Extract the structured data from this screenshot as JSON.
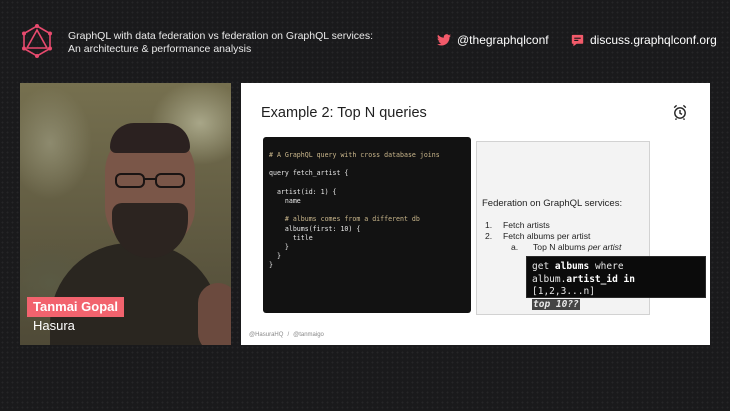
{
  "header": {
    "event_title_line1": "GraphQL with data federation vs federation on GraphQL services:",
    "event_title_line2": "An architecture & performance analysis",
    "twitter_handle": "@thegraphqlconf",
    "discuss_url": "discuss.graphqlconf.org",
    "icons": {
      "logo": "graphql-conf-logo",
      "twitter": "twitter-icon",
      "discuss": "chat-icon"
    },
    "colors": {
      "logo": "#e84a6e",
      "twitter": "#f25a6a",
      "discuss": "#f25a6a"
    }
  },
  "speaker": {
    "name": "Tanmai Gopal",
    "company": "Hasura",
    "name_tag_color": "#f2636e"
  },
  "slide": {
    "title": "Example 2: Top N queries",
    "icon": "alarm-clock-icon",
    "code_lines": [
      {
        "text": "# A GraphQL query with cross database joins",
        "comment": true
      },
      {
        "text": "",
        "comment": false
      },
      {
        "text": "query fetch_artist {",
        "comment": false
      },
      {
        "text": "",
        "comment": false
      },
      {
        "text": "  artist(id: 1) {",
        "comment": false
      },
      {
        "text": "    name",
        "comment": false
      },
      {
        "text": "",
        "comment": false
      },
      {
        "text": "    # albums comes from a different db",
        "comment": true
      },
      {
        "text": "    albums(first: 10) {",
        "comment": false
      },
      {
        "text": "      title",
        "comment": false
      },
      {
        "text": "    }",
        "comment": false
      },
      {
        "text": "  }",
        "comment": false
      },
      {
        "text": "}",
        "comment": false
      }
    ],
    "notes": {
      "heading": "Federation on GraphQL services:",
      "items": [
        {
          "num": "1.",
          "text": "Fetch artists"
        },
        {
          "num": "2.",
          "text": "Fetch albums per artist"
        }
      ],
      "subitem": {
        "num": "a.",
        "text": "Top N albums ",
        "italic": "per artist"
      }
    },
    "footer": {
      "handle1": "@HasuraHQ",
      "sep": "/",
      "handle2": "@tanmaigo"
    }
  },
  "overlay": {
    "w_get": "get ",
    "w_albums": "albums",
    "w_where": " where",
    "w_prefix": "album.",
    "w_field": "artist_id",
    "w_in": " in",
    "w_list": " [1,2,3...n]",
    "w_topn": "top 10??"
  }
}
